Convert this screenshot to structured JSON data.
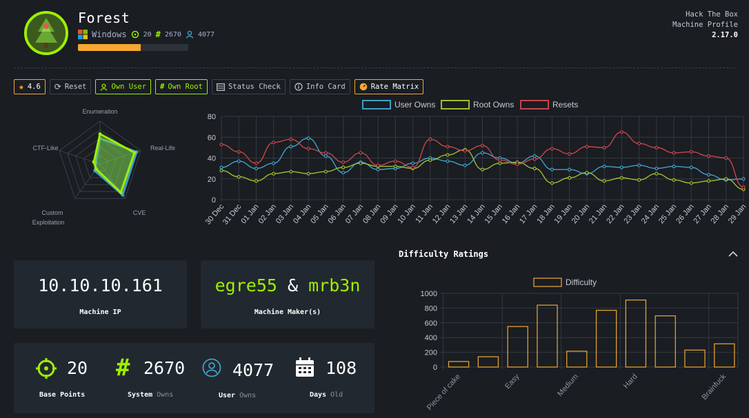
{
  "header": {
    "title": "Forest",
    "os": "Windows",
    "points": "20",
    "system_owns": "2670",
    "user_owns": "4077",
    "progress": 0.57,
    "brand_line1": "Hack The Box",
    "brand_line2": "Machine Profile",
    "version": "2.17.0"
  },
  "toolbar": {
    "rating": "4.6",
    "reset": "Reset",
    "own_user": "Own User",
    "own_root": "Own Root",
    "status_check": "Status Check",
    "info_card": "Info Card",
    "rate_matrix": "Rate Matrix"
  },
  "radar": {
    "labels": [
      "Enumeration",
      "Real-Life",
      "CVE",
      "Custom Exploitation",
      "CTF-Like"
    ],
    "series": [
      {
        "name": "blue",
        "values": [
          6,
          9,
          9,
          2,
          1
        ],
        "color": "#41a0c8"
      },
      {
        "name": "green",
        "values": [
          7,
          8.5,
          8.3,
          1.5,
          1.5
        ],
        "color": "#9fef00"
      }
    ],
    "max": 10
  },
  "chart_data": [
    {
      "type": "line",
      "x": [
        "30 Dec",
        "31 Dec",
        "01 Jan",
        "02 Jan",
        "03 Jan",
        "04 Jan",
        "05 Jan",
        "06 Jan",
        "07 Jan",
        "08 Jan",
        "09 Jan",
        "10 Jan",
        "11 Jan",
        "12 Jan",
        "13 Jan",
        "14 Jan",
        "15 Jan",
        "16 Jan",
        "17 Jan",
        "18 Jan",
        "19 Jan",
        "20 Jan",
        "21 Jan",
        "22 Jan",
        "23 Jan",
        "24 Jan",
        "25 Jan",
        "26 Jan",
        "27 Jan",
        "28 Jan",
        "29 Jan"
      ],
      "series": [
        {
          "name": "User Owns",
          "color": "#41a0c8",
          "values": [
            31,
            37,
            30,
            35,
            51,
            59,
            42,
            26,
            36,
            29,
            30,
            35,
            40,
            37,
            33,
            45,
            40,
            35,
            42,
            29,
            29,
            25,
            32,
            31,
            33,
            30,
            32,
            31,
            24,
            19,
            20
          ]
        },
        {
          "name": "Root Owns",
          "color": "#9fbf30",
          "values": [
            28,
            22,
            18,
            25,
            27,
            25,
            27,
            31,
            35,
            32,
            32,
            30,
            38,
            43,
            48,
            29,
            35,
            36,
            30,
            16,
            21,
            26,
            18,
            21,
            19,
            25,
            19,
            16,
            18,
            20,
            10
          ]
        },
        {
          "name": "Resets",
          "color": "#c8454c",
          "values": [
            53,
            46,
            35,
            55,
            58,
            49,
            45,
            36,
            45,
            33,
            37,
            31,
            58,
            51,
            47,
            52,
            38,
            34,
            39,
            49,
            44,
            51,
            50,
            65,
            54,
            50,
            45,
            46,
            42,
            40,
            12
          ]
        }
      ],
      "ylim": [
        0,
        80
      ],
      "yticks": [
        0,
        20,
        40,
        60,
        80
      ],
      "grid": true,
      "legend": "top"
    },
    {
      "type": "bar",
      "title": "Difficulty Ratings",
      "categories": [
        "Piece of cake",
        "",
        "Easy",
        "",
        "Medium",
        "",
        "Hard",
        "",
        "",
        "Brainfuck"
      ],
      "values": [
        75,
        140,
        550,
        840,
        215,
        770,
        910,
        695,
        230,
        315
      ],
      "series_name": "Difficulty",
      "ylim": [
        0,
        1000
      ],
      "yticks": [
        0,
        200,
        400,
        600,
        800,
        1000
      ],
      "color": "#e0a030",
      "legend": "top"
    }
  ],
  "cards": {
    "ip": "10.10.10.161",
    "ip_label": "Machine IP",
    "maker1": "egre55",
    "maker_sep": "&",
    "maker2": "mrb3n",
    "maker_label": "Machine Maker(s)",
    "base_points": "20",
    "base_points_label": "Base Points",
    "system": "2670",
    "system_label": "System",
    "system_sub": "Owns",
    "user": "4077",
    "user_label": "User",
    "user_sub": "Owns",
    "days": "108",
    "days_label": "Days",
    "days_sub": "Old"
  },
  "colors": {
    "accent_green": "#9fef00",
    "accent_orange": "#f7a82f",
    "accent_blue": "#41a0c8"
  }
}
